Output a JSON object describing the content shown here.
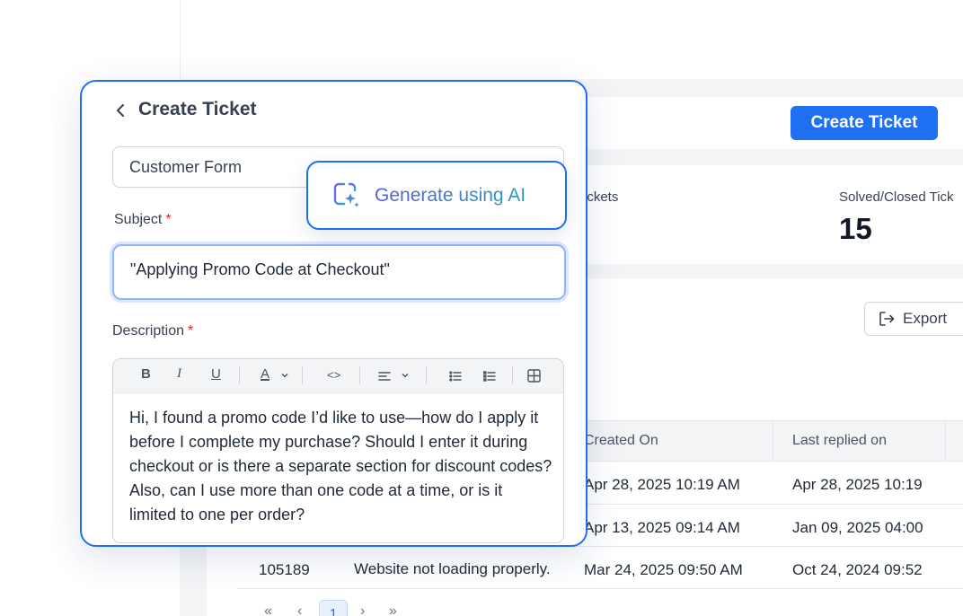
{
  "dashboard": {
    "create_button_label": "Create Ticket",
    "stats": {
      "label_1": "ickets",
      "label_2": "Solved/Closed Tick",
      "value_2": "15"
    },
    "export_label": "Export",
    "table": {
      "headers": [
        "Created On",
        "Last replied on"
      ],
      "rows": [
        {
          "id": "",
          "subject": "",
          "created": "Apr 28, 2025 10:19 AM",
          "replied": "Apr 28, 2025 10:19"
        },
        {
          "id": "",
          "subject": "",
          "created": "Apr 13, 2025 09:14 AM",
          "replied": "Jan 09, 2025 04:00"
        },
        {
          "id": "105189",
          "subject": "Website not loading properly.",
          "created": "Mar 24, 2025 09:50 AM",
          "replied": "Oct 24, 2024 09:52"
        }
      ]
    },
    "pagination": {
      "first": "«",
      "prev": "‹",
      "current": "1",
      "next": "›",
      "last": "»"
    }
  },
  "modal": {
    "title": "Create Ticket",
    "form_type": "Customer Form",
    "subject_label": "Subject",
    "required_mark": "*",
    "subject_value": "\"Applying Promo Code at Checkout\"",
    "description_label": "Description",
    "toolbar": {
      "bold": "B",
      "italic": "I",
      "underline": "U",
      "text_color": "A",
      "code": "<>"
    },
    "description_value": "Hi,  I found a promo code I’d like to use—how do I apply it before I complete my purchase? Should I enter it during checkout or is there a separate section for discount codes? Also, can I use more than one code at a time, or is it limited to one per order?"
  },
  "ai_button": {
    "label": "Generate using AI"
  },
  "colors": {
    "accent": "#1e6ff2",
    "required": "#dc2626",
    "ai_gradient_start": "#5b5bd6",
    "ai_gradient_end": "#2a9dbf"
  }
}
